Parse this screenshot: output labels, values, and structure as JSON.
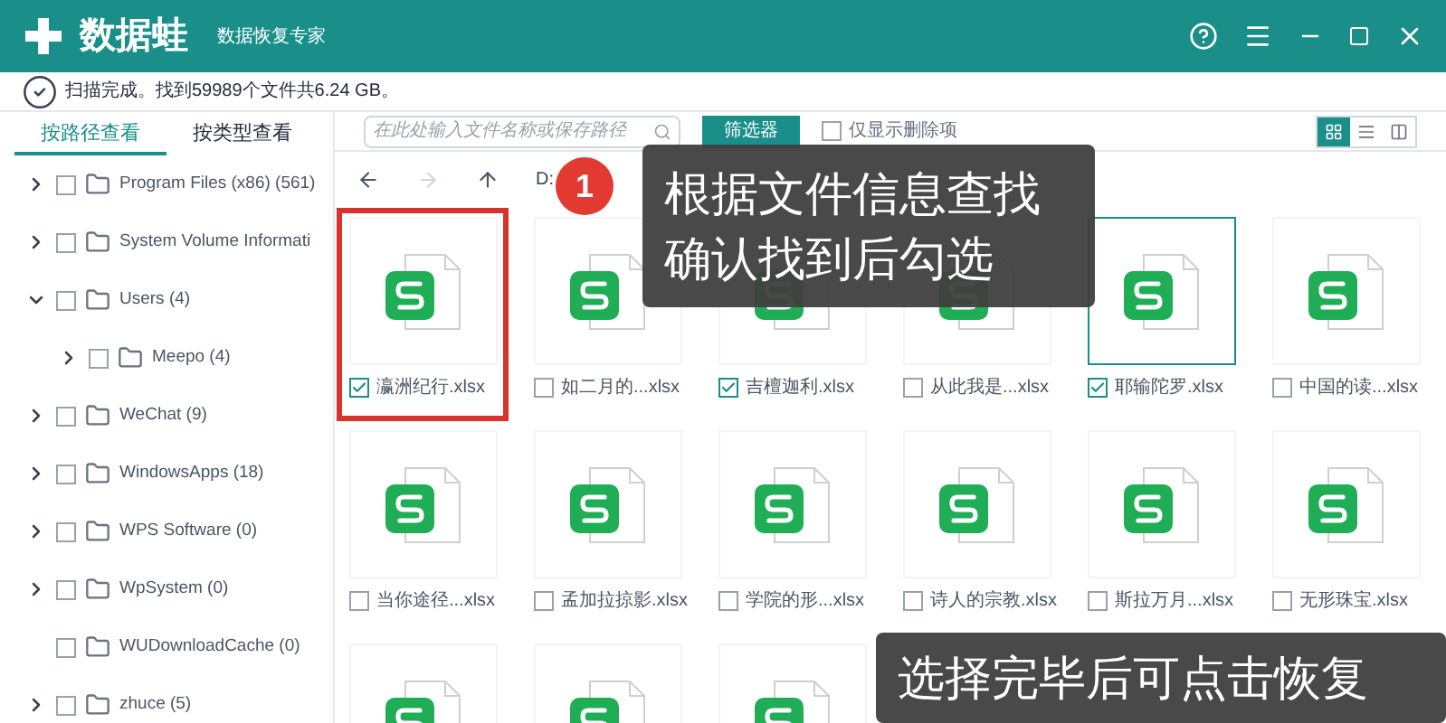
{
  "app": {
    "logo": "数据蛙",
    "subtitle": "数据恢复专家"
  },
  "status": "扫描完成。找到59989个文件共6.24 GB。",
  "tabs": [
    {
      "label": "按路径查看",
      "selected": true
    },
    {
      "label": "按类型查看",
      "selected": false
    }
  ],
  "search": {
    "placeholder": "在此处输入文件名称或保存路径"
  },
  "filter_button": "筛选器",
  "deleted_only": {
    "label": "仅显示删除项",
    "checked": false
  },
  "views": [
    {
      "kind": "grid",
      "selected": true
    },
    {
      "kind": "list",
      "selected": false
    },
    {
      "kind": "columns",
      "selected": false
    }
  ],
  "path": "D:",
  "tree": [
    {
      "label": "Program Files (x86) (561)",
      "checked": false,
      "expanded": false
    },
    {
      "label": "System Volume Informati",
      "checked": false,
      "expanded": false
    },
    {
      "label": "Users (4)",
      "checked": false,
      "expanded": true,
      "children": [
        {
          "label": "Meepo (4)",
          "checked": false,
          "expanded": false
        }
      ]
    },
    {
      "label": "WeChat (9)",
      "checked": false,
      "expanded": false
    },
    {
      "label": "WindowsApps (18)",
      "checked": false,
      "expanded": false
    },
    {
      "label": "WPS Software (0)",
      "checked": false,
      "expanded": false
    },
    {
      "label": "WpSystem (0)",
      "checked": false,
      "expanded": false
    },
    {
      "label": "WUDownloadCache (0)",
      "checked": false
    },
    {
      "label": "zhuce (5)",
      "checked": false,
      "expanded": false
    }
  ],
  "files": [
    {
      "name": "瀛洲纪行.xlsx",
      "checked": true,
      "selected": false,
      "highlighted": true
    },
    {
      "name": "如二月的...xlsx",
      "checked": false,
      "selected": false,
      "highlighted": false
    },
    {
      "name": "吉檀迦利.xlsx",
      "checked": true,
      "selected": false,
      "highlighted": false
    },
    {
      "name": "从此我是...xlsx",
      "checked": false,
      "selected": false,
      "highlighted": false
    },
    {
      "name": "耶输陀罗.xlsx",
      "checked": true,
      "selected": true,
      "highlighted": false
    },
    {
      "name": "中国的读...xlsx",
      "checked": false,
      "selected": false,
      "highlighted": false
    },
    {
      "name": "当你途径...xlsx",
      "checked": false,
      "selected": false,
      "highlighted": false
    },
    {
      "name": "孟加拉掠影.xlsx",
      "checked": false,
      "selected": false,
      "highlighted": false
    },
    {
      "name": "学院的形...xlsx",
      "checked": false,
      "selected": false,
      "highlighted": false
    },
    {
      "name": "诗人的宗教.xlsx",
      "checked": false,
      "selected": false,
      "highlighted": false
    },
    {
      "name": "斯拉万月...xlsx",
      "checked": false,
      "selected": false,
      "highlighted": false
    },
    {
      "name": "无形珠宝.xlsx",
      "checked": false,
      "selected": false,
      "highlighted": false
    }
  ],
  "hint_1": {
    "badge": "1",
    "lines": [
      "根据文件信息查找",
      "确认找到后勾选"
    ]
  },
  "hint_2": {
    "text": "选择完毕后可点击恢复"
  }
}
